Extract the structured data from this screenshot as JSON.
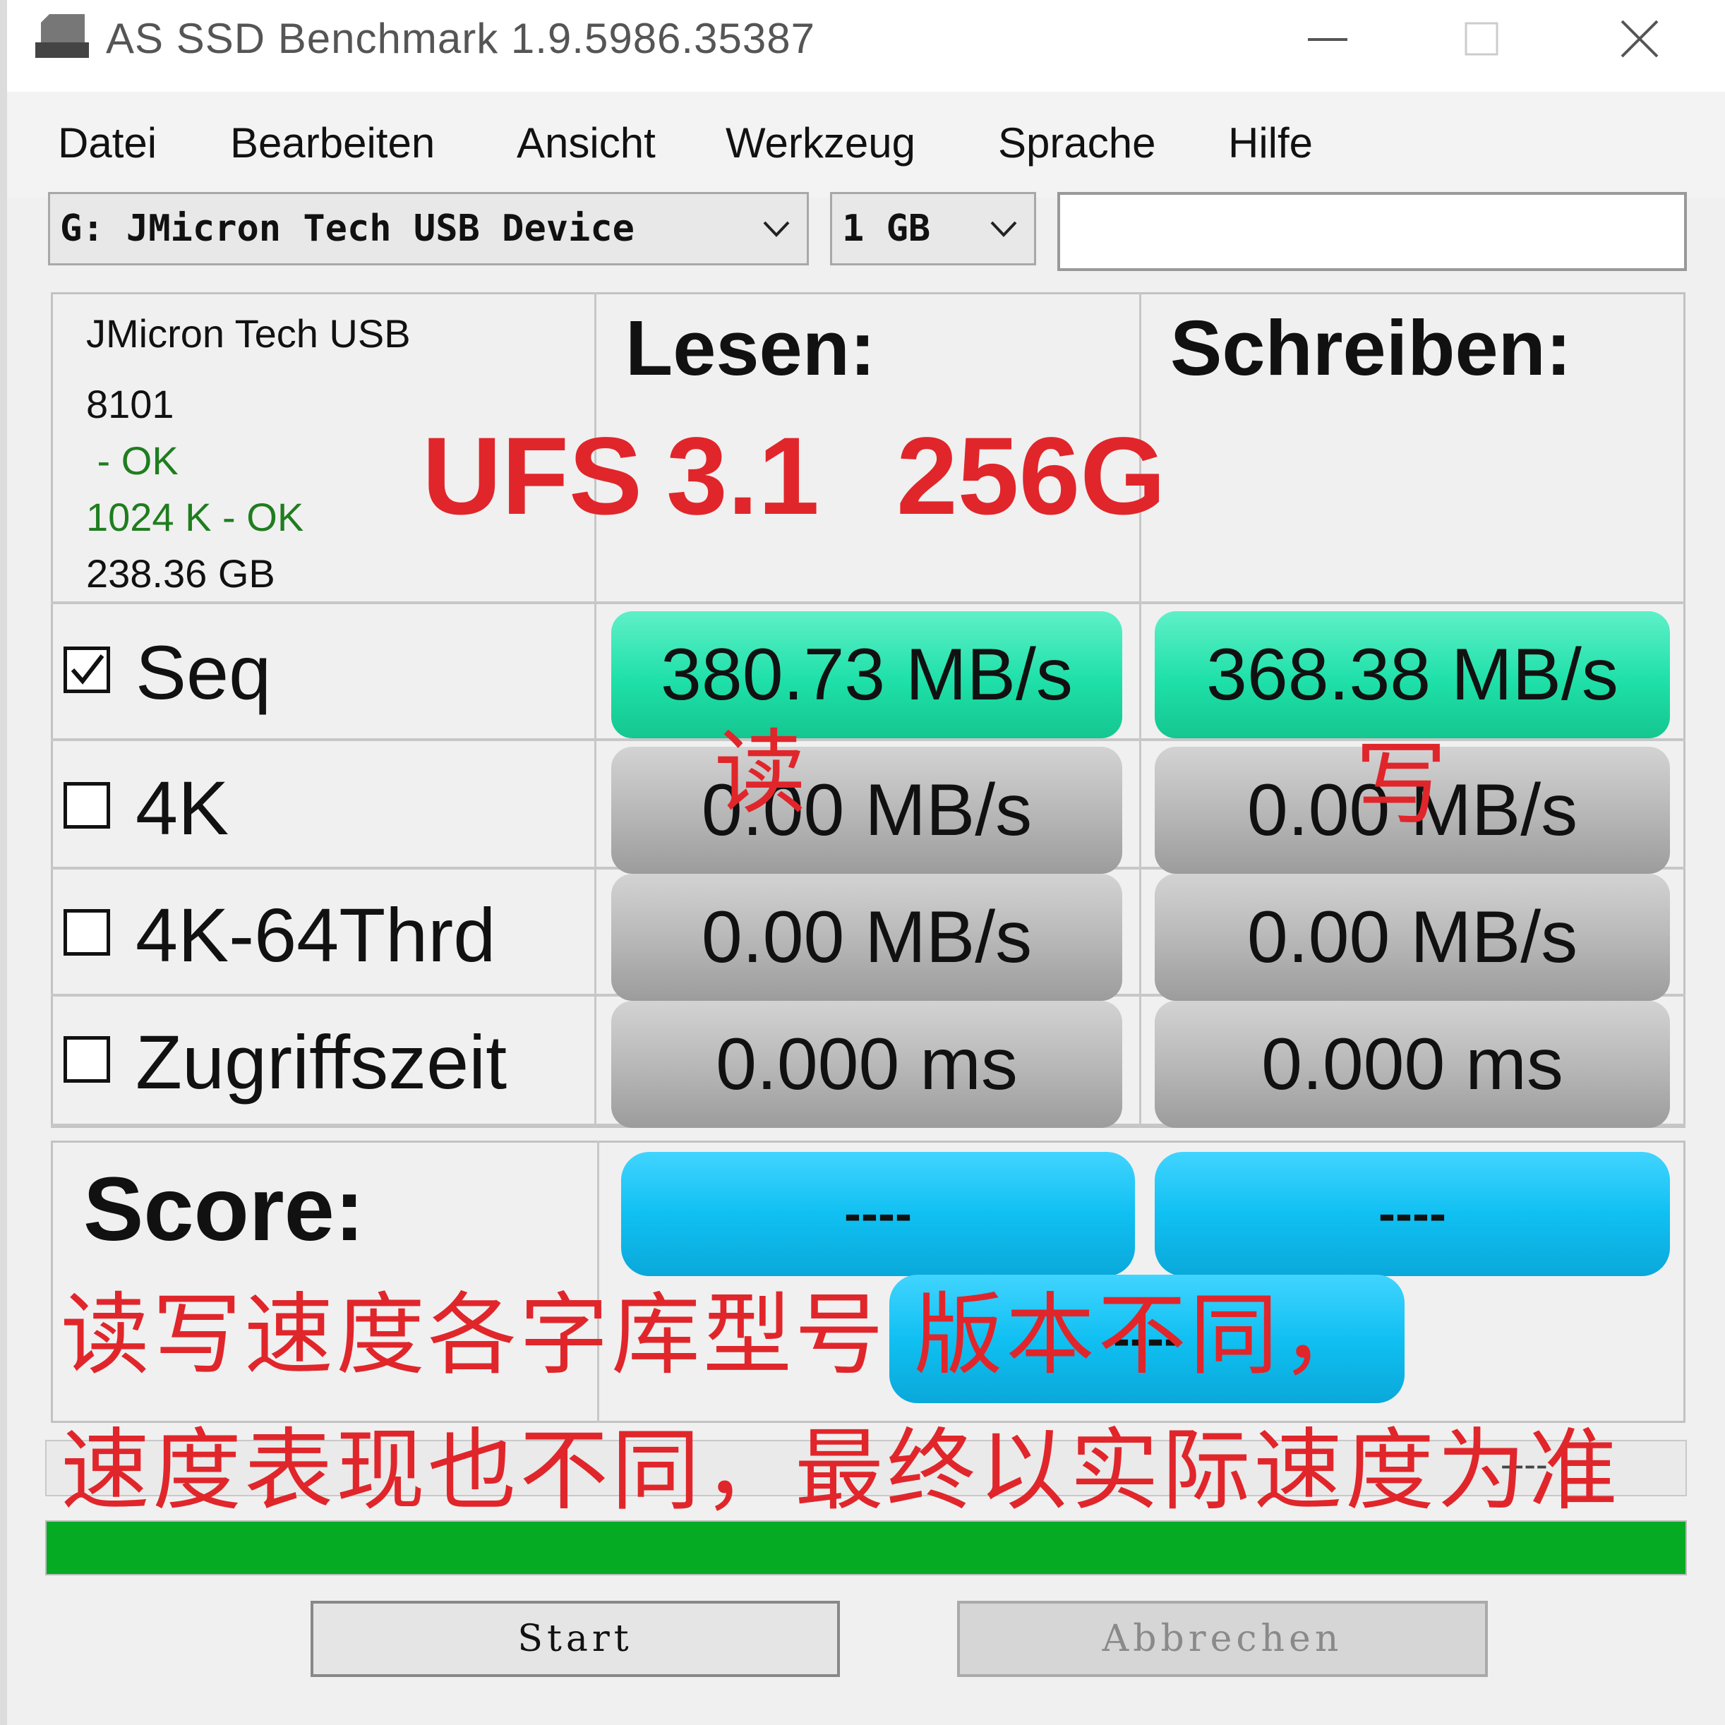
{
  "window": {
    "title": "AS SSD Benchmark 1.9.5986.35387"
  },
  "menu": [
    "Datei",
    "Bearbeiten",
    "Ansicht",
    "Werkzeug",
    "Sprache",
    "Hilfe"
  ],
  "toolbar": {
    "drive_select": "G: JMicron Tech USB Device",
    "size_select": "1 GB",
    "path_value": ""
  },
  "drive_info": {
    "name": "JMicron Tech USB",
    "firmware": "8101",
    "status_1": " - OK",
    "status_2": "1024 K - OK",
    "capacity": "238.36 GB"
  },
  "headers": {
    "read": "Lesen:",
    "write": "Schreiben:"
  },
  "rows": [
    {
      "label": "Seq",
      "checked": true,
      "read": "380.73 MB/s",
      "write": "368.38 MB/s"
    },
    {
      "label": "4K",
      "checked": false,
      "read": "0.00 MB/s",
      "write": "0.00 MB/s"
    },
    {
      "label": "4K-64Thrd",
      "checked": false,
      "read": "0.00 MB/s",
      "write": "0.00 MB/s"
    },
    {
      "label": "Zugriffszeit",
      "checked": false,
      "read": "0.000 ms",
      "write": "0.000 ms"
    }
  ],
  "score": {
    "label": "Score:",
    "read": "----",
    "write": "----",
    "total": "----",
    "footer": "----"
  },
  "overlay": {
    "model_parts": [
      "UFS",
      "3.1",
      "256G"
    ],
    "read_mark": "读",
    "write_mark": "写",
    "note_line1": "读写速度各字库型号 版本不同，",
    "note_line2": "速度表现也不同，最终以实际速度为准"
  },
  "progress": {
    "value": 1.0
  },
  "buttons": {
    "start": "Start",
    "cancel": "Abbrechen"
  },
  "colors": {
    "result_active": "#1ee0a8",
    "result_idle": "#b3b3b3",
    "score": "#10c0f2",
    "progress": "#05ab23",
    "overlay_text": "#e0262b"
  }
}
